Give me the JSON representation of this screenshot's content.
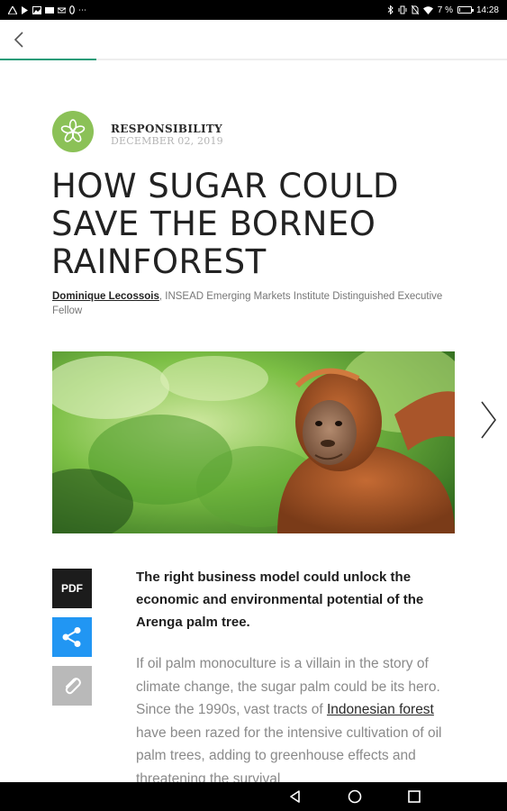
{
  "status_bar": {
    "left_icons": [
      "warning-icon",
      "play-icon",
      "gallery-icon",
      "photo-icon",
      "message-icon",
      "link-icon",
      "more-dots-icon"
    ],
    "right_icons": [
      "bluetooth-icon",
      "vibrate-icon",
      "no-sim-icon",
      "wifi-icon"
    ],
    "battery": "7 %",
    "battery_level_percent": 7,
    "time": "14:28"
  },
  "top_bar": {
    "back_icon": "chevron-left-icon",
    "reading_progress_fraction": 0.19,
    "accent_color": "#1f9c78"
  },
  "article": {
    "category": "RESPONSIBILITY",
    "category_icon": "flower-icon",
    "category_color": "#8bc157",
    "date": "DECEMBER 02, 2019",
    "title": "HOW SUGAR COULD SAVE THE BORNEO RAINFOREST",
    "author": "Dominique Lecossois",
    "author_role": ", INSEAD Emerging Markets Institute Distinguished Executive Fellow",
    "image_subject": "orangutan-photo",
    "next_icon": "chevron-right-icon",
    "actions": {
      "pdf_label": "PDF",
      "share_icon": "share-icon",
      "attach_icon": "paperclip-icon",
      "pdf_color": "#1c1c1c",
      "share_color": "#2196f3",
      "attach_color": "#b9b9b9"
    },
    "lede": "The right business model could unlock the economic and environmental potential of the Arenga palm tree.",
    "body_part1": "If oil palm monoculture is a villain in the story of climate change, the sugar palm could be its hero. Since the 1990s, vast tracts of ",
    "body_link": "Indonesian forest",
    "body_part2": " have been razed for the intensive cultivation of oil palm trees, adding to greenhouse effects and threatening the survival"
  },
  "nav_bar": {
    "back_icon": "triangle-back-icon",
    "home_icon": "circle-home-icon",
    "recents_icon": "square-recents-icon"
  }
}
